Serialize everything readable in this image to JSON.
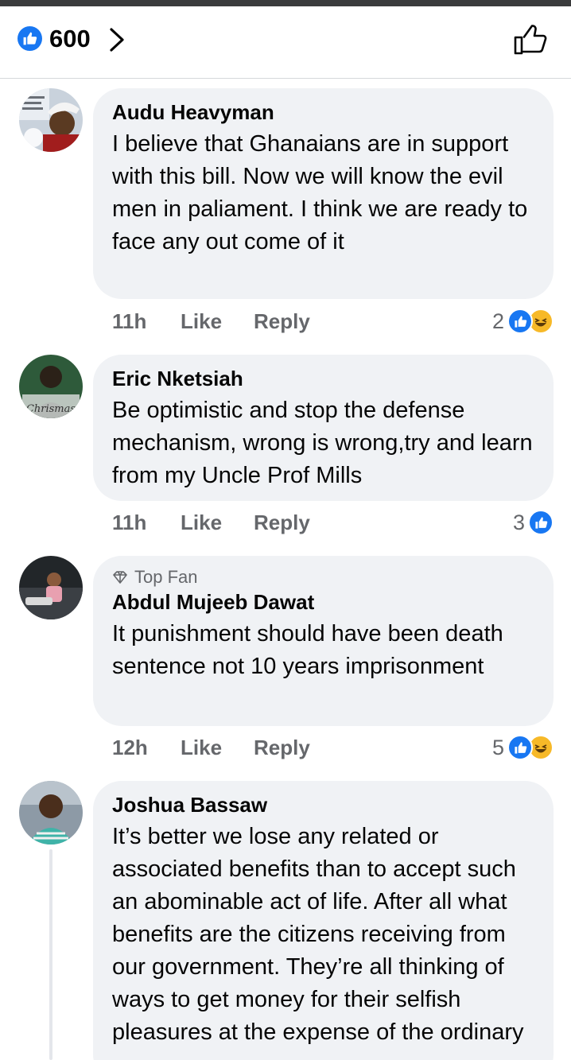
{
  "header": {
    "reaction_count": "600",
    "like_icon": "like-icon",
    "chevron_icon": "chevron-right-icon",
    "thumb_icon": "thumbs-up-outline-icon"
  },
  "colors": {
    "brand_blue": "#1877f2",
    "bubble_bg": "#f0f2f5",
    "meta_gray": "#65676b",
    "haha_yellow": "#f7b928"
  },
  "comments": [
    {
      "author": "Audu Heavyman",
      "text": "I believe that Ghanaians are in support with this bill. Now we will know the evil men in paliament. I think we are ready to face any out come of it",
      "time": "11h",
      "like_label": "Like",
      "reply_label": "Reply",
      "reaction_count": "2"
    },
    {
      "author": "Eric Nketsiah",
      "text": "Be optimistic and stop the defense mechanism, wrong is wrong,try and learn from my Uncle Prof Mills",
      "time": "11h",
      "like_label": "Like",
      "reply_label": "Reply",
      "reaction_count": "3"
    },
    {
      "badge": "Top Fan",
      "author": "Abdul Mujeeb Dawat",
      "text": "It punishment should have been death sentence not 10 years imprisonment",
      "time": "12h",
      "like_label": "Like",
      "reply_label": "Reply",
      "reaction_count": "5"
    },
    {
      "author": "Joshua Bassaw",
      "text": "It’s better we lose any related or associated benefits than to accept such an abominable act of life. After all what benefits are the citizens receiving from our government. They’re all thinking of ways to get money for their selfish pleasures at the expense of the ordinary"
    }
  ]
}
